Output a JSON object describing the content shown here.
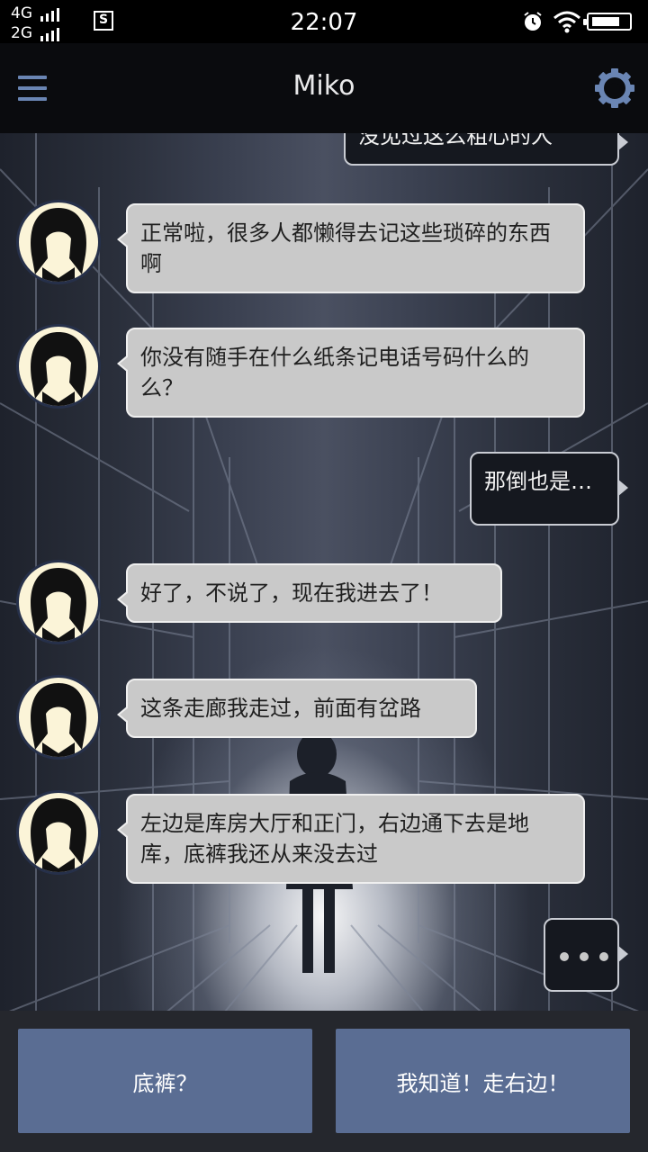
{
  "status_bar": {
    "network_top": "4G",
    "network_bottom": "2G",
    "sim_label": "S",
    "time": "22:07"
  },
  "header": {
    "title": "Miko",
    "menu_icon": "hamburger-menu-icon",
    "settings_icon": "gear-icon"
  },
  "colors": {
    "header_accent": "#6a85b3",
    "incoming_bubble": "#c9c9c9",
    "outgoing_bubble": "#15181f",
    "choice_button": "#5a6d93"
  },
  "messages": [
    {
      "from": "player",
      "text": "没见过这么粗心的人",
      "partial": true
    },
    {
      "from": "miko",
      "text": "正常啦，很多人都懒得去记这些琐碎的东西啊"
    },
    {
      "from": "miko",
      "text": "你没有随手在什么纸条记电话号码什么的么？"
    },
    {
      "from": "player",
      "text": "那倒也是…"
    },
    {
      "from": "miko",
      "text": "好了，不说了，现在我进去了！"
    },
    {
      "from": "miko",
      "text": "这条走廊我走过，前面有岔路"
    },
    {
      "from": "miko",
      "text": "左边是库房大厅和正门，右边通下去是地库，底裤我还从来没去过"
    },
    {
      "from": "player",
      "text": "",
      "typing": true
    }
  ],
  "choices": [
    {
      "label": "底裤？"
    },
    {
      "label": "我知道！走右边！"
    }
  ]
}
